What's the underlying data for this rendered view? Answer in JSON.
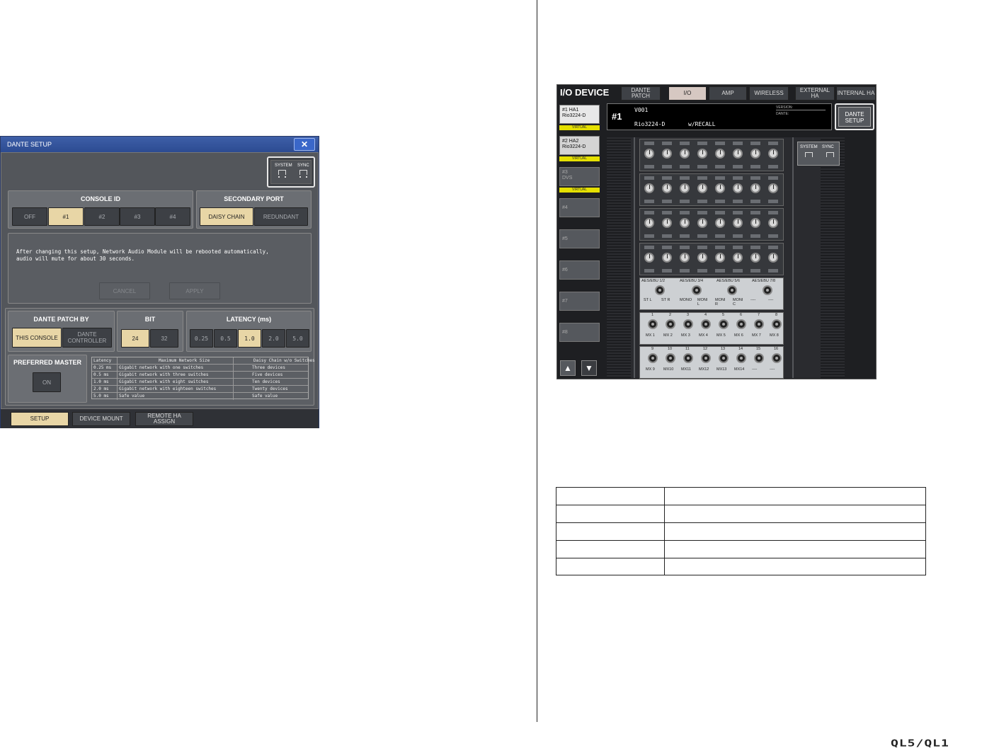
{
  "dante_setup": {
    "title": "DANTE SETUP",
    "close": "✕",
    "system_label": "SYSTEM",
    "sync_label": "SYNC",
    "console_id": {
      "title": "CONSOLE ID",
      "options": [
        "OFF",
        "#1",
        "#2",
        "#3",
        "#4"
      ],
      "selected": "#1"
    },
    "secondary_port": {
      "title": "SECONDARY PORT",
      "options": [
        "DAISY CHAIN",
        "REDUNDANT"
      ],
      "selected": "DAISY CHAIN"
    },
    "message_line1": "After changing this setup, Network Audio Module will be rebooted automatically,",
    "message_line2": "audio will mute for about 30 seconds.",
    "cancel": "CANCEL",
    "apply": "APPLY",
    "dante_patch_by": {
      "title": "DANTE PATCH BY",
      "opt1": "THIS CONSOLE",
      "opt2": "DANTE CONTROLLER"
    },
    "bit": {
      "title": "BIT",
      "options": [
        "24",
        "32"
      ],
      "selected": "24"
    },
    "latency": {
      "title": "LATENCY (ms)",
      "options": [
        "0.25",
        "0.5",
        "1.0",
        "2.0",
        "5.0"
      ],
      "selected": "1.0"
    },
    "preferred_master": {
      "title": "PREFERRED MASTER",
      "button": "ON"
    },
    "latency_table": {
      "headers": [
        "Latency",
        "Maximum Network Size",
        "Daisy Chain w/o Switches"
      ],
      "rows": [
        [
          "0.25 ms",
          "Gigabit network with   one   switches",
          "Three devices"
        ],
        [
          "0.5  ms",
          "Gigabit network with  three  switches",
          "Five devices"
        ],
        [
          "1.0  ms",
          "Gigabit network with  eight  switches",
          "Ten devices"
        ],
        [
          "2.0  ms",
          "Gigabit network with eighteen switches",
          "Twenty devices"
        ],
        [
          "5.0  ms",
          "Safe value",
          "Safe value"
        ]
      ]
    },
    "tabs": [
      "SETUP",
      "DEVICE MOUNT",
      "REMOTE HA ASSIGN"
    ]
  },
  "io_device": {
    "title": "I/O DEVICE",
    "tabs": [
      "DANTE PATCH",
      "I/O",
      "AMP",
      "WIRELESS",
      "EXTERNAL HA",
      "INTERNAL HA"
    ],
    "slots": [
      {
        "l1": "#1 HA1",
        "l2": "Rio3224-D",
        "tag": "VIRTUAL"
      },
      {
        "l1": "#2 HA2",
        "l2": "Rio3224-D",
        "tag": "VIRTUAL"
      },
      {
        "l1": "#3",
        "l2": "DVS",
        "tag": "VIRTUAL"
      },
      {
        "l1": "#4",
        "l2": "",
        "tag": ""
      },
      {
        "l1": "#5",
        "l2": "",
        "tag": ""
      },
      {
        "l1": "#6",
        "l2": "",
        "tag": ""
      },
      {
        "l1": "#7",
        "l2": "",
        "tag": ""
      },
      {
        "l1": "#8",
        "l2": "",
        "tag": ""
      }
    ],
    "info": {
      "id": "#1",
      "version": "V001",
      "model": "Rio3224-D",
      "recall": "w/RECALL",
      "version_label": "VERSION:",
      "dante_label": "DANTE:"
    },
    "dante_setup_btn": "DANTE SETUP",
    "system_label": "SYSTEM",
    "sync_label": "SYNC",
    "aes_labels": [
      "AES/EBU 1/2",
      "AES/EBU 3/4",
      "AES/EBU 5/6",
      "AES/EBU 7/8"
    ],
    "aes_outs": [
      "ST L",
      "ST R",
      "MONO",
      "MONI L",
      "MONI R",
      "MONI C",
      "----",
      "----"
    ],
    "mix_nums_1": [
      "1",
      "2",
      "3",
      "4",
      "5",
      "6",
      "7",
      "8"
    ],
    "mix_outs_1": [
      "MX 1",
      "MX 2",
      "MX 3",
      "MX 4",
      "MX 5",
      "MX 6",
      "MX 7",
      "MX 8"
    ],
    "mix_nums_2": [
      "9",
      "10",
      "11",
      "12",
      "13",
      "14",
      "15",
      "16"
    ],
    "mix_outs_2": [
      "MX 9",
      "MX10",
      "MX11",
      "MX12",
      "MX13",
      "MX14",
      "----",
      "----"
    ]
  },
  "brand": "QL5/QL1"
}
